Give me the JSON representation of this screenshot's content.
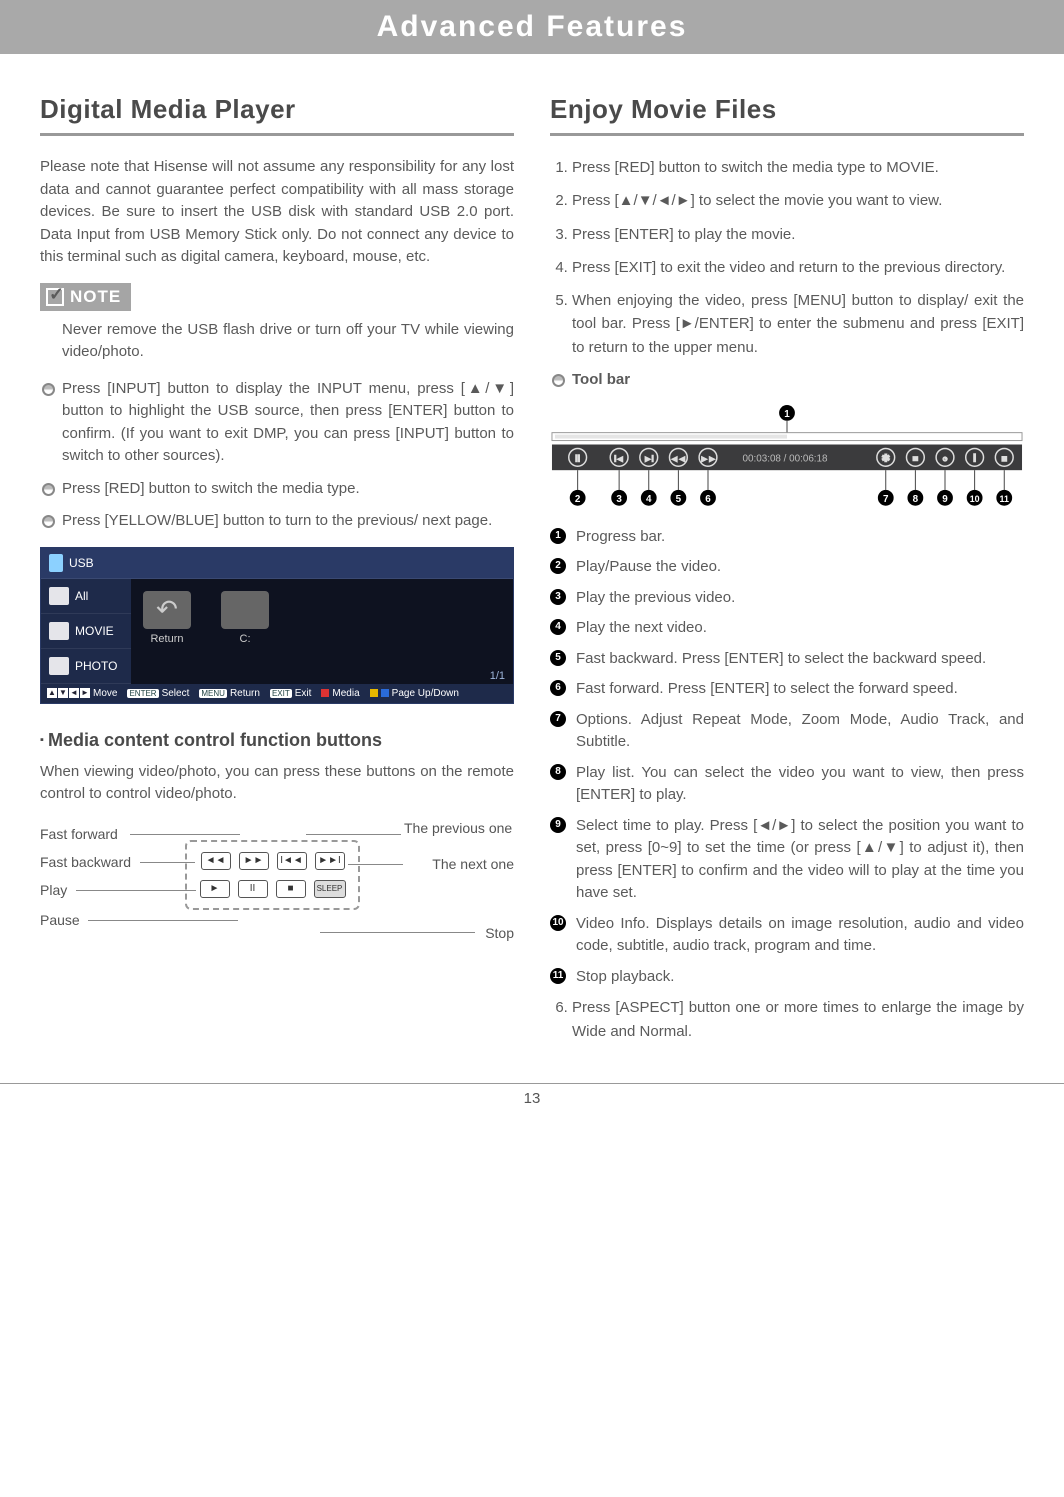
{
  "header": {
    "title": "Advanced Features"
  },
  "left": {
    "title": "Digital Media Player",
    "intro": "Please note that Hisense will not assume any responsibility for any lost data and cannot guarantee perfect compatibility with all mass storage devices. Be sure to insert the USB disk with standard USB 2.0 port. Data Input from USB Memory Stick only. Do not connect any device to this terminal such as digital camera, keyboard, mouse, etc.",
    "note_label": "NOTE",
    "note_text": "Never remove the USB flash drive or turn off your TV while viewing video/photo.",
    "bullets": [
      "Press [INPUT] button to display the INPUT menu, press [▲/▼] button to highlight the USB source, then press [ENTER] button to confirm. (If you want to exit DMP, you can press [INPUT] button to switch to other sources).",
      "Press [RED] button to switch the media type.",
      "Press [YELLOW/BLUE] button to turn to the previous/ next page."
    ],
    "screenshot": {
      "usb_label": "USB",
      "side_items": [
        "All",
        "MOVIE",
        "PHOTO"
      ],
      "folders": [
        "Return",
        "C:"
      ],
      "page_indicator": "1/1",
      "footer": {
        "move": "Move",
        "select": "Select",
        "select_key": "ENTER",
        "return": "Return",
        "return_key": "MENU",
        "exit": "Exit",
        "exit_key": "EXIT",
        "media": "Media",
        "page": "Page Up/Down"
      }
    },
    "subhead": "Media content control function buttons",
    "subtext": "When viewing video/photo, you can press these buttons on the remote control to control video/photo.",
    "remote_labels": {
      "ff": "Fast forward",
      "fb": "Fast backward",
      "play": "Play",
      "pause": "Pause",
      "prev": "The previous one",
      "next": "The next one",
      "stop": "Stop",
      "sleep": "SLEEP"
    }
  },
  "right": {
    "title": "Enjoy Movie Files",
    "steps": [
      "Press [RED] button to switch the media type to MOVIE.",
      "Press [▲/▼/◄/►] to select the movie you want to view.",
      "Press [ENTER] to play the movie.",
      "Press [EXIT] to exit the video and return to the previous directory.",
      "When enjoying the video, press [MENU] button to display/ exit the tool bar. Press [►/ENTER] to enter the submenu and press [EXIT] to return to the upper menu."
    ],
    "toolbar_label": "Tool bar",
    "toolbar": {
      "time": "00:03:08 / 00:06:18"
    },
    "legend": [
      "Progress bar.",
      "Play/Pause the video.",
      "Play the previous video.",
      "Play the next video.",
      "Fast backward. Press [ENTER] to select the backward speed.",
      "Fast forward. Press [ENTER] to select the forward speed.",
      "Options. Adjust Repeat Mode, Zoom Mode, Audio Track, and Subtitle.",
      "Play list. You can select the video you want to view, then press [ENTER] to play.",
      "Select time to play. Press [◄/►] to select the position you want to set, press [0~9] to set the time (or press [▲/▼] to adjust it), then press [ENTER] to confirm and the video will to play at the time you have set.",
      "Video Info. Displays details on image resolution, audio and video code, subtitle, audio track, program and time.",
      "Stop playback."
    ],
    "step6": "Press [ASPECT] button one or more times to enlarge the image by Wide and Normal."
  },
  "page_number": "13"
}
